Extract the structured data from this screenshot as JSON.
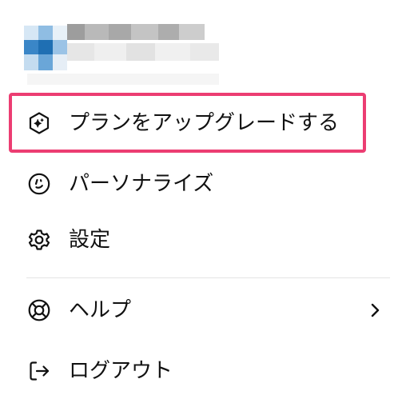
{
  "menu": {
    "upgrade_label": "プランをアップグレードする",
    "personalize_label": "パーソナライズ",
    "settings_label": "設定",
    "help_label": "ヘルプ",
    "logout_label": "ログアウト"
  },
  "colors": {
    "highlight_border": "#ec3d72",
    "avatar_blue": "#2f7fc2",
    "divider": "#e3e3e3"
  }
}
